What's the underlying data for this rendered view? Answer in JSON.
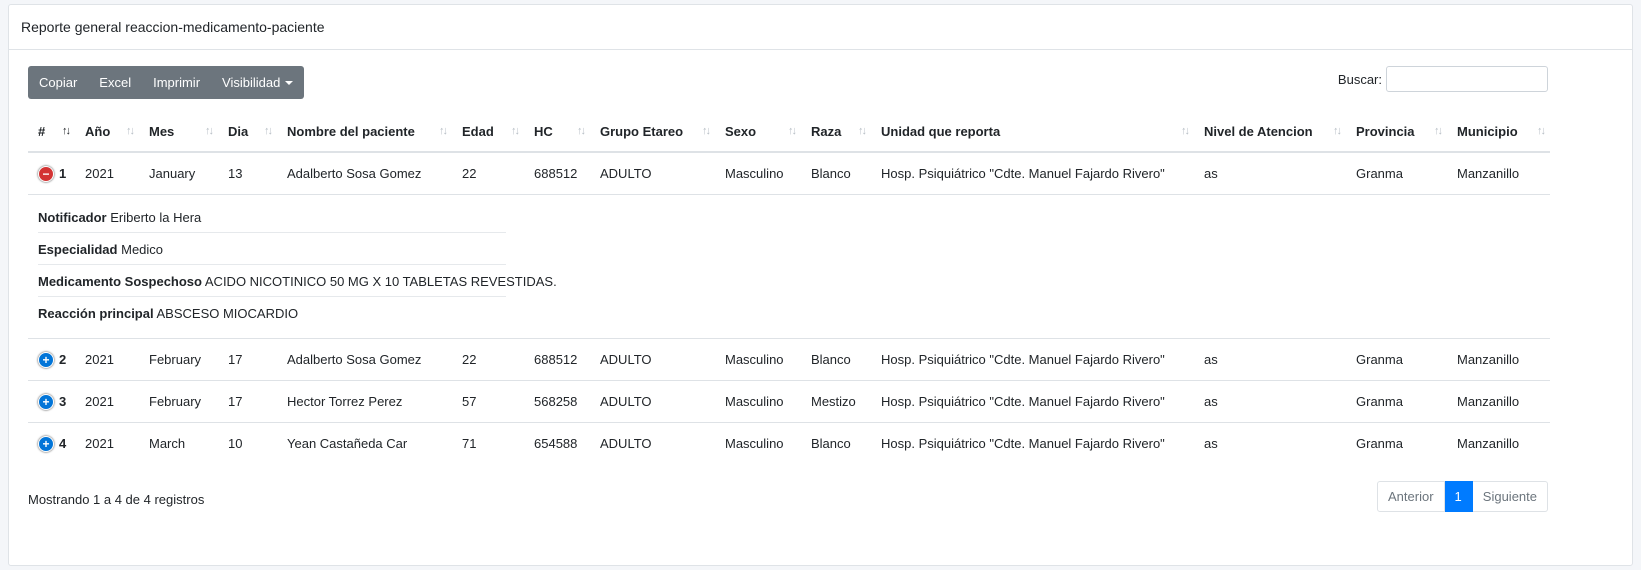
{
  "header": {
    "title": "Reporte general reaccion-medicamento-paciente"
  },
  "toolbar": {
    "copy": "Copiar",
    "excel": "Excel",
    "print": "Imprimir",
    "visibility": "Visibilidad"
  },
  "search": {
    "label": "Buscar:",
    "value": ""
  },
  "columns": [
    "#",
    "Año",
    "Mes",
    "Dia",
    "Nombre del paciente",
    "Edad",
    "HC",
    "Grupo Etareo",
    "Sexo",
    "Raza",
    "Unidad que reporta",
    "Nivel de Atencion",
    "Provincia",
    "Municipio"
  ],
  "rows": [
    {
      "num": "1",
      "anio": "2021",
      "mes": "January",
      "dia": "13",
      "nombre": "Adalberto Sosa Gomez",
      "edad": "22",
      "hc": "688512",
      "grupo": "ADULTO",
      "sexo": "Masculino",
      "raza": "Blanco",
      "unidad": "Hosp. Psiquiátrico \"Cdte. Manuel Fajardo Rivero\"",
      "nivel": "as",
      "provincia": "Granma",
      "municipio": "Manzanillo"
    },
    {
      "num": "2",
      "anio": "2021",
      "mes": "February",
      "dia": "17",
      "nombre": "Adalberto Sosa Gomez",
      "edad": "22",
      "hc": "688512",
      "grupo": "ADULTO",
      "sexo": "Masculino",
      "raza": "Blanco",
      "unidad": "Hosp. Psiquiátrico \"Cdte. Manuel Fajardo Rivero\"",
      "nivel": "as",
      "provincia": "Granma",
      "municipio": "Manzanillo"
    },
    {
      "num": "3",
      "anio": "2021",
      "mes": "February",
      "dia": "17",
      "nombre": "Hector Torrez Perez",
      "edad": "57",
      "hc": "568258",
      "grupo": "ADULTO",
      "sexo": "Masculino",
      "raza": "Mestizo",
      "unidad": "Hosp. Psiquiátrico \"Cdte. Manuel Fajardo Rivero\"",
      "nivel": "as",
      "provincia": "Granma",
      "municipio": "Manzanillo"
    },
    {
      "num": "4",
      "anio": "2021",
      "mes": "March",
      "dia": "10",
      "nombre": "Yean Castañeda Car",
      "edad": "71",
      "hc": "654588",
      "grupo": "ADULTO",
      "sexo": "Masculino",
      "raza": "Blanco",
      "unidad": "Hosp. Psiquiátrico \"Cdte. Manuel Fajardo Rivero\"",
      "nivel": "as",
      "provincia": "Granma",
      "municipio": "Manzanillo"
    }
  ],
  "detail": {
    "notificador_label": "Notificador",
    "notificador_value": "Eriberto la Hera",
    "especialidad_label": "Especialidad",
    "especialidad_value": "Medico",
    "medicamento_label": "Medicamento Sospechoso",
    "medicamento_value": "ACIDO NICOTINICO 50 MG X 10 TABLETAS REVESTIDAS.",
    "reaccion_label": "Reacción principal",
    "reaccion_value": "ABSCESO MIOCARDIO"
  },
  "footer": {
    "info": "Mostrando 1 a 4 de 4 registros"
  },
  "pagination": {
    "prev": "Anterior",
    "current": "1",
    "next": "Siguiente"
  },
  "colors": {
    "toolbar": "#6c757d",
    "active_page": "#007bff",
    "minus": "#d33333",
    "plus": "#0275d8"
  },
  "icons": {
    "expanded": "minus-circle-icon",
    "collapsed": "plus-circle-icon",
    "sort": "sort-arrows-icon",
    "caret": "caret-down-icon"
  }
}
